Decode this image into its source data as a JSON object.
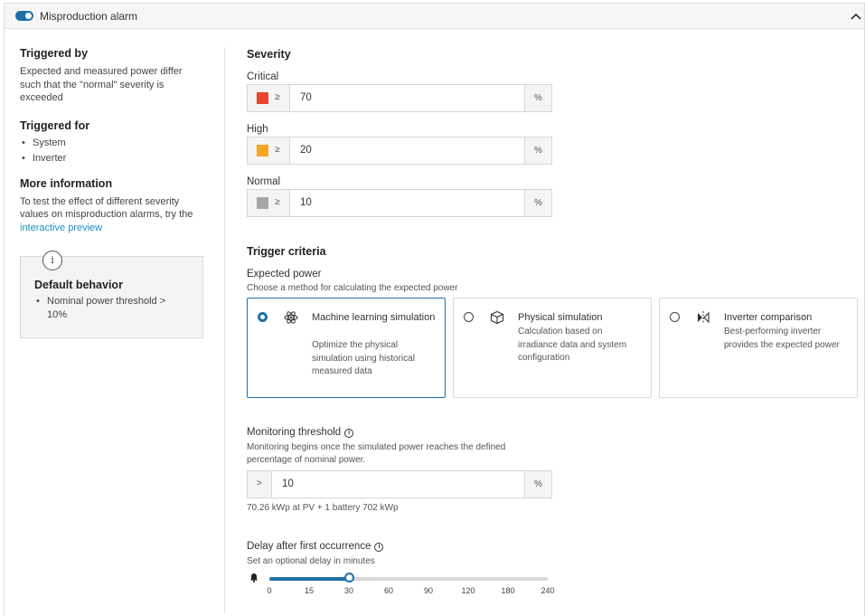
{
  "header": {
    "title": "Misproduction alarm",
    "toggle_on": true
  },
  "left": {
    "triggered_by": {
      "title": "Triggered by",
      "text": "Expected and measured power differ such that the \"normal\" severity is exceeded"
    },
    "triggered_for": {
      "title": "Triggered for",
      "items": [
        "System",
        "Inverter"
      ]
    },
    "more_info": {
      "title": "More information",
      "text_before": "To test the effect of different severity values on misproduction alarms, try the ",
      "link": "interactive preview"
    },
    "default_behavior": {
      "icon": "info-icon",
      "glyph": "i",
      "title": "Default behavior",
      "items": [
        "Nominal power threshold > 10%"
      ]
    }
  },
  "severity": {
    "title": "Severity",
    "operator": "≥",
    "unit": "%",
    "levels": [
      {
        "label": "Critical",
        "value": "70",
        "color": "#e8472e"
      },
      {
        "label": "High",
        "value": "20",
        "color": "#f5a623"
      },
      {
        "label": "Normal",
        "value": "10",
        "color": "#a6a6a6"
      }
    ]
  },
  "trigger": {
    "title": "Trigger criteria",
    "expected_power": {
      "label": "Expected power",
      "hint": "Choose a method for calculating the expected power"
    },
    "methods": [
      {
        "title": "Machine learning simulation",
        "desc": "Optimize the physical simulation using historical measured data",
        "icon": "atom-icon",
        "selected": true
      },
      {
        "title": "Physical simulation",
        "desc": "Calculation based on irradiance data and system configuration",
        "icon": "cube-icon",
        "selected": false
      },
      {
        "title": "Inverter comparison",
        "desc": "Best-performing inverter provides the expected power",
        "icon": "inverter-compare-icon",
        "selected": false
      }
    ]
  },
  "monitoring": {
    "label": "Monitoring threshold",
    "hint": "Monitoring begins once the simulated power reaches the defined percentage of nominal power.",
    "operator": ">",
    "value": "10",
    "unit": "%",
    "note": "70.26 kWp at PV + 1 battery 702 kWp",
    "info_glyph": "i"
  },
  "delay": {
    "label": "Delay after first occurrence",
    "hint": "Set an optional delay in minutes",
    "ticks": [
      "0",
      "15",
      "30",
      "60",
      "90",
      "120",
      "180",
      "240"
    ],
    "value_index": 2,
    "info_glyph": "i",
    "icon": "bell-icon"
  }
}
